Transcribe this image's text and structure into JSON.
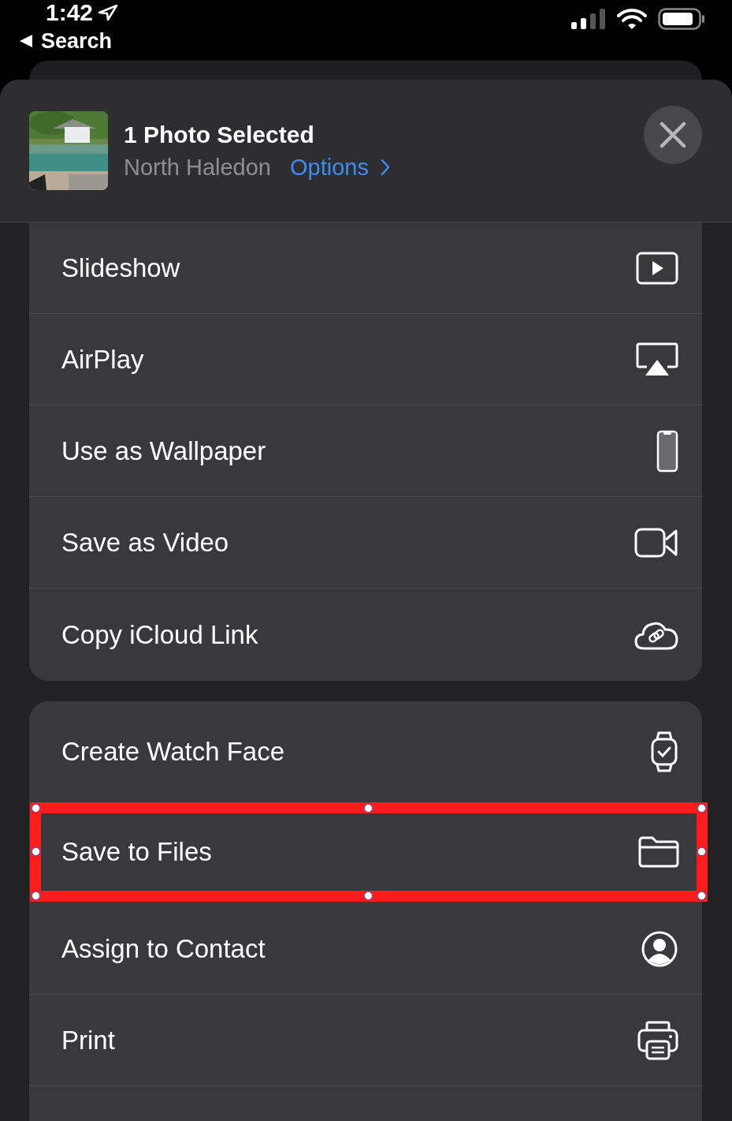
{
  "status_bar": {
    "time": "1:42"
  },
  "back": {
    "label": "Search"
  },
  "sheet": {
    "title": "1 Photo Selected",
    "location": "North Haledon",
    "options": "Options"
  },
  "groups": [
    {
      "items": [
        {
          "label": "Slideshow",
          "kind": "slideshow",
          "highlighted": false
        },
        {
          "label": "AirPlay",
          "kind": "airplay",
          "highlighted": false
        },
        {
          "label": "Use as Wallpaper",
          "kind": "wallpaper",
          "highlighted": false
        },
        {
          "label": "Save as Video",
          "kind": "video",
          "highlighted": false
        },
        {
          "label": "Copy iCloud Link",
          "kind": "cloud-link",
          "highlighted": false
        }
      ]
    },
    {
      "items": [
        {
          "label": "Create Watch Face",
          "kind": "watch",
          "highlighted": false
        },
        {
          "label": "Save to Files",
          "kind": "folder",
          "highlighted": true
        },
        {
          "label": "Assign to Contact",
          "kind": "contact",
          "highlighted": false
        },
        {
          "label": "Print",
          "kind": "print",
          "highlighted": false
        }
      ]
    }
  ]
}
